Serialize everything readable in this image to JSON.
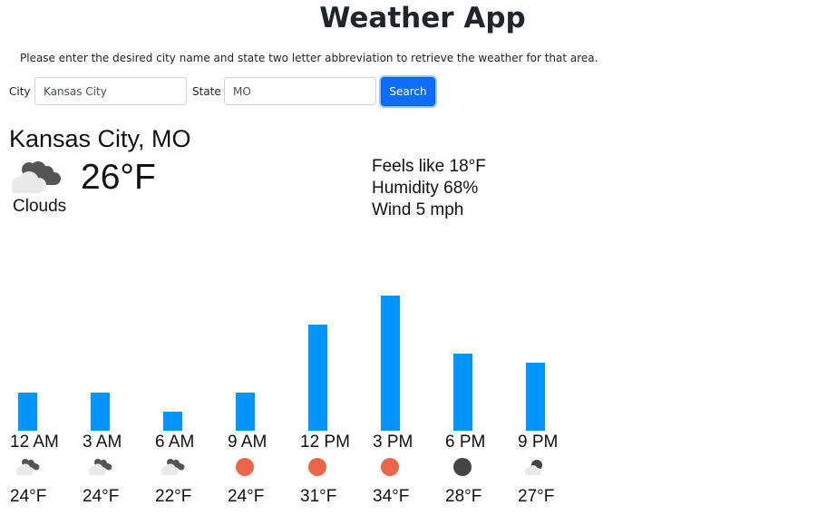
{
  "header": {
    "title": "Weather App",
    "instructions": "Please enter the desired city name and state two letter abbreviation to retrieve the weather for that area."
  },
  "search": {
    "city_label": "City",
    "city_value": "Kansas City",
    "state_label": "State",
    "state_value": "MO",
    "button_label": "Search"
  },
  "current": {
    "location": "Kansas City, MO",
    "temperature": "26°F",
    "condition": "Clouds",
    "condition_icon": "clouds-icon",
    "feels_like": "Feels like 18°F",
    "humidity": "Humidity 68%",
    "wind": "Wind 5 mph"
  },
  "colors": {
    "bar": "#0094ff",
    "button": "#0d6efd",
    "sun": "#e8674a",
    "night": "#444444",
    "cloud_light": "#e9e9e9",
    "cloud_dark": "#555555"
  },
  "chart_data": {
    "type": "bar",
    "categories": [
      "12 AM",
      "3 AM",
      "6 AM",
      "9 AM",
      "12 PM",
      "3 PM",
      "6 PM",
      "9 PM"
    ],
    "values": [
      24,
      24,
      22,
      24,
      31,
      34,
      28,
      27
    ],
    "value_labels": [
      "24°F",
      "24°F",
      "22°F",
      "24°F",
      "31°F",
      "34°F",
      "28°F",
      "27°F"
    ],
    "icons": [
      "clouds-icon",
      "clouds-icon",
      "clouds-icon",
      "sun-icon",
      "sun-icon",
      "sun-icon",
      "moon-icon",
      "partly-cloudy-night-icon"
    ]
  }
}
